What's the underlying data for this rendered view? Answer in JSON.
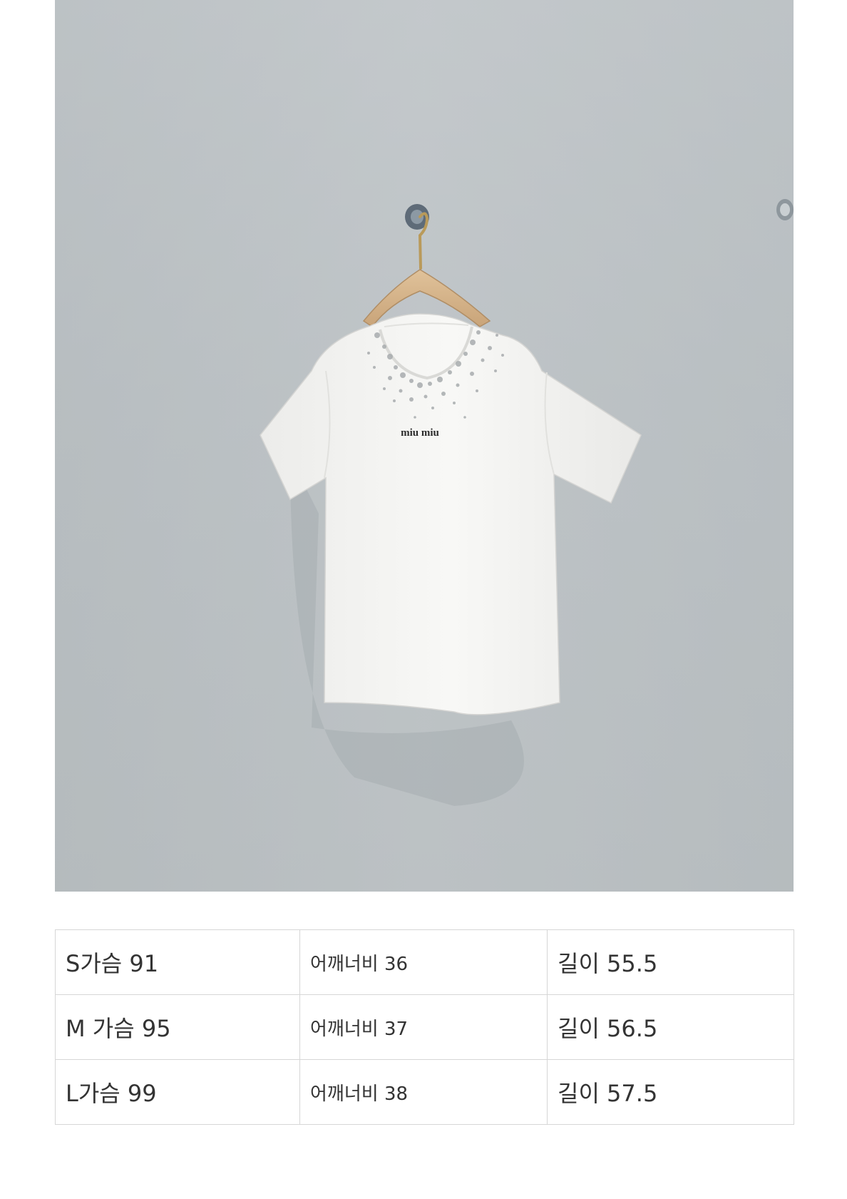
{
  "photo": {
    "brand_print": "miu miu",
    "colors": {
      "wall": "#bcc2c5",
      "shirt": "#f6f6f4",
      "hanger": "#d9b88f"
    }
  },
  "size_table": {
    "rows": [
      {
        "size": "S가슴 91",
        "shoulder": "어깨너비 36",
        "length": "길이 55.5"
      },
      {
        "size": "M 가슴 95",
        "shoulder": "어깨너비 37",
        "length": "길이 56.5"
      },
      {
        "size": "L가슴 99",
        "shoulder": "어깨너비 38",
        "length": "길이 57.5"
      }
    ]
  }
}
